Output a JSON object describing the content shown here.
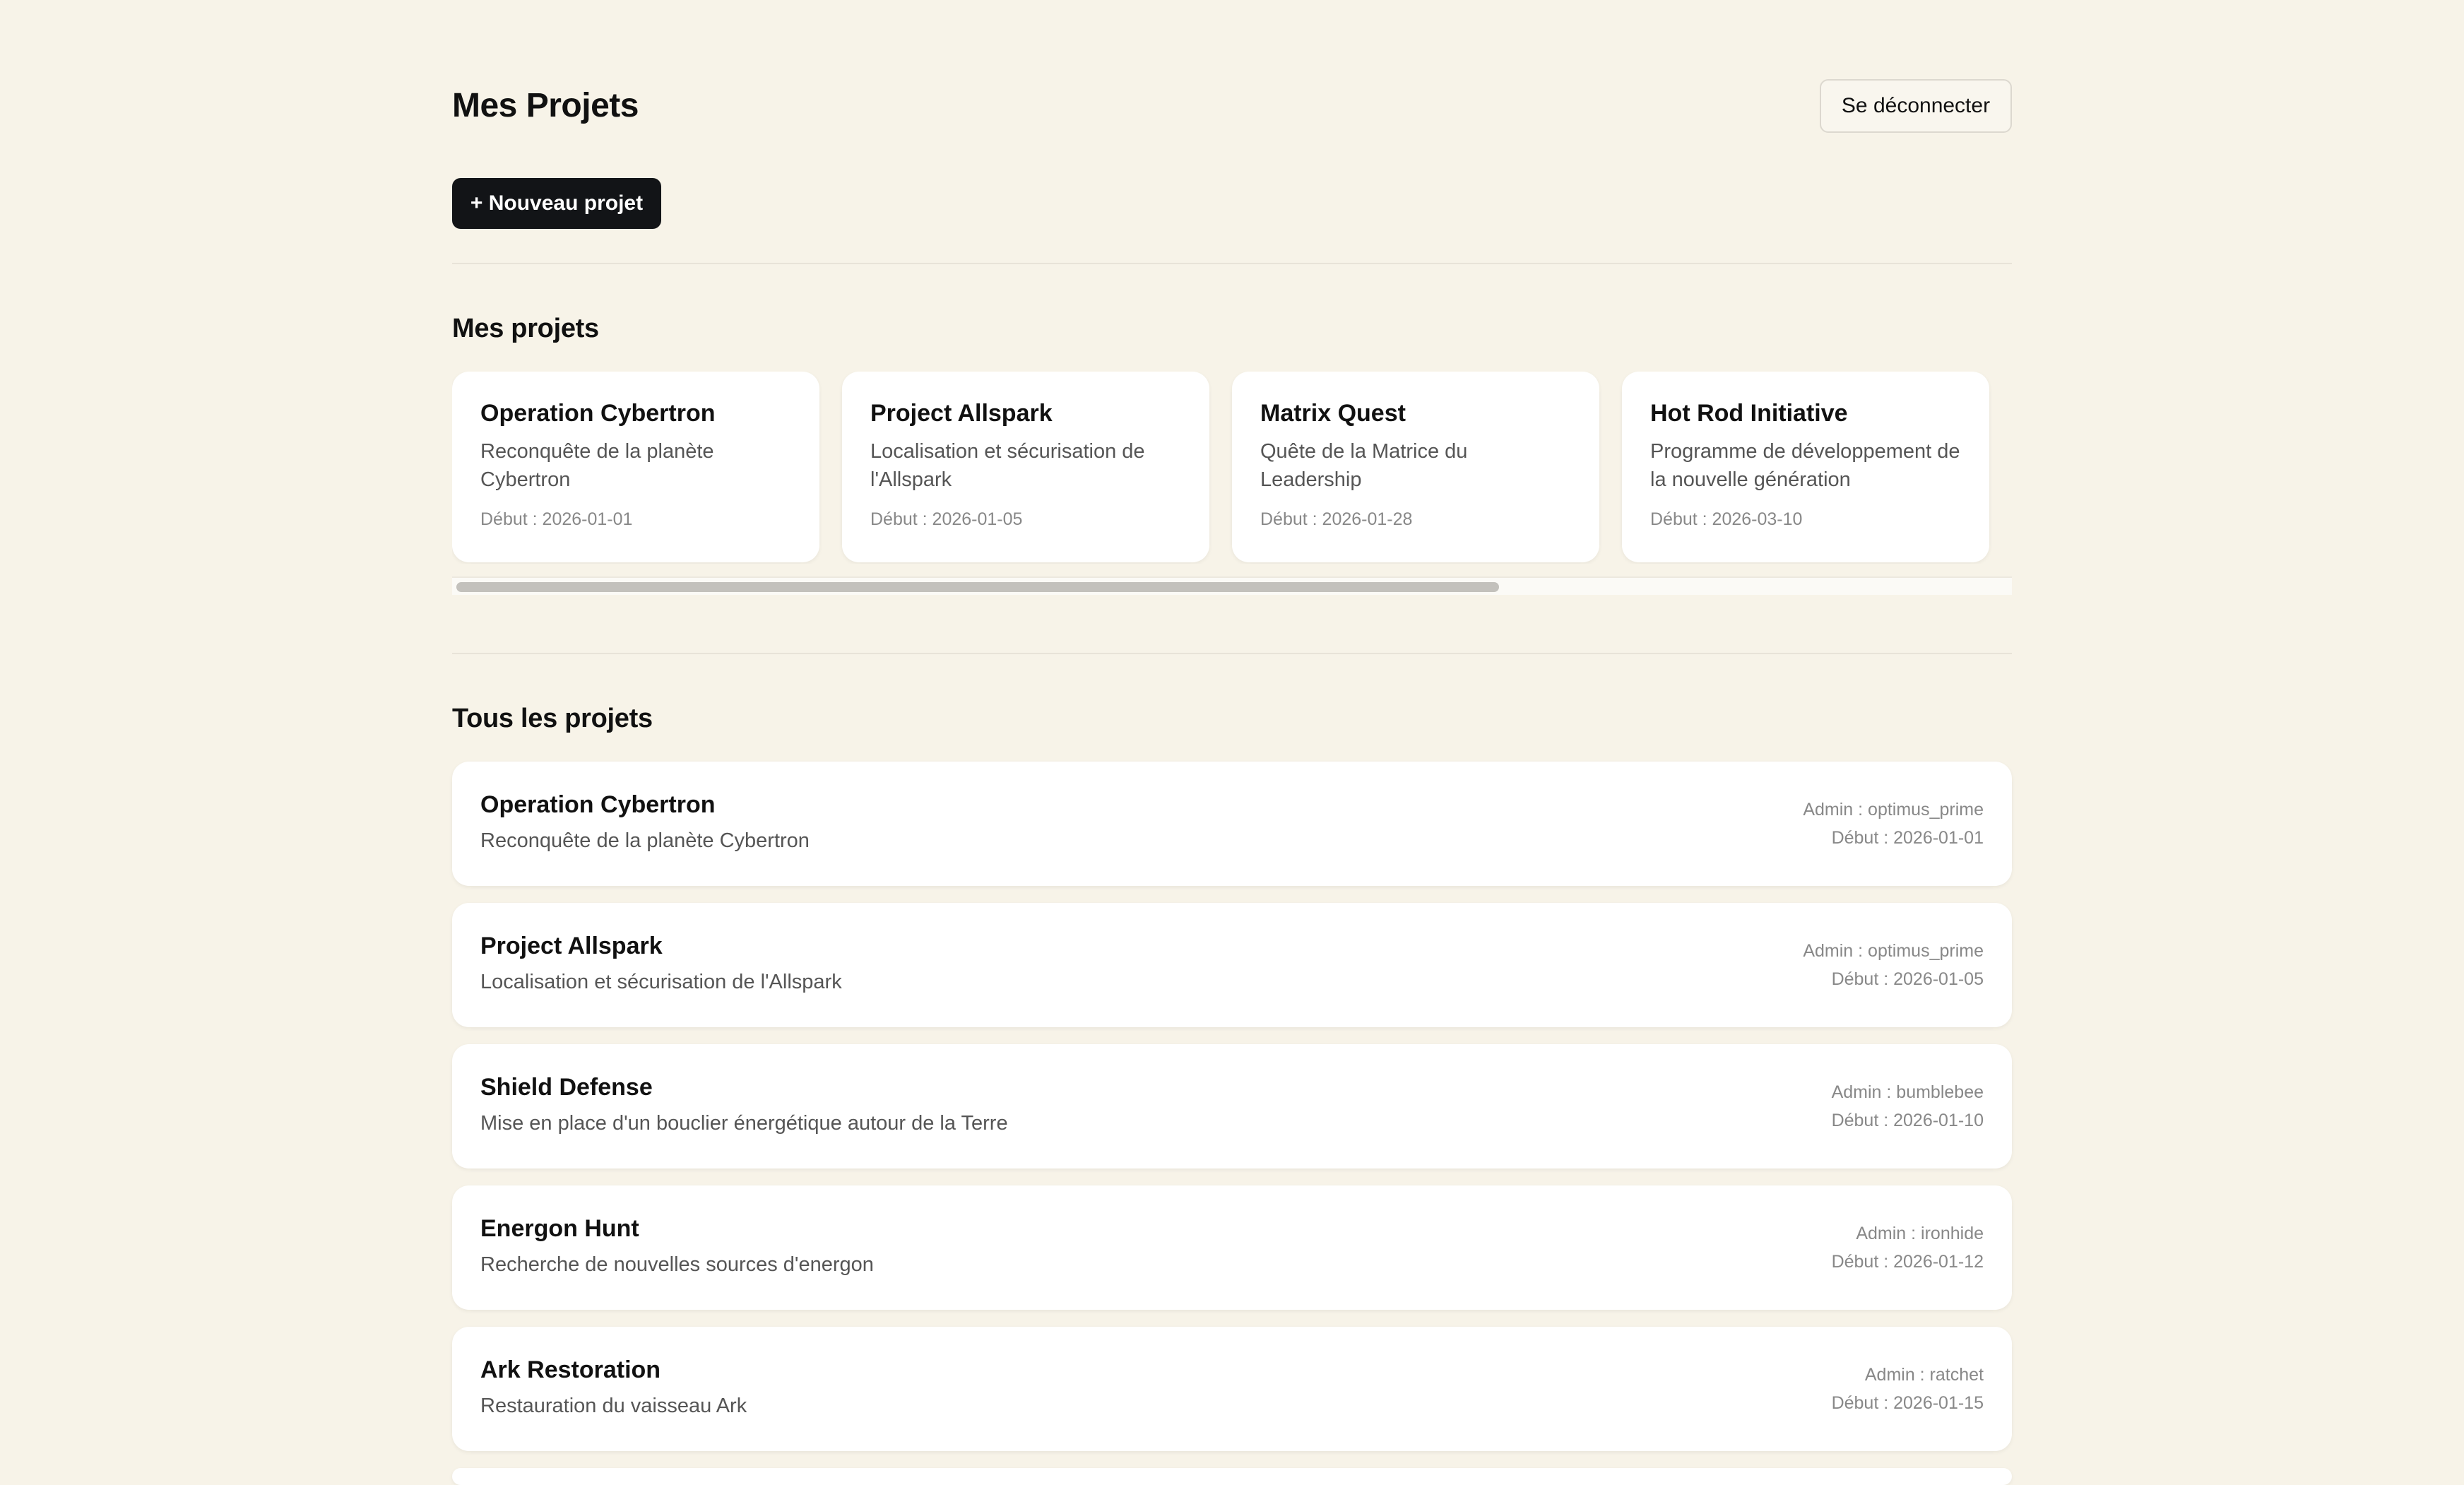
{
  "header": {
    "title": "Mes Projets",
    "logout_label": "Se déconnecter"
  },
  "toolbar": {
    "new_project_label": "+ Nouveau projet"
  },
  "my_projects": {
    "title": "Mes projets",
    "cards": [
      {
        "name": "Operation Cybertron",
        "desc": "Reconquête de la planète Cybertron",
        "date": "Début : 2026-01-01"
      },
      {
        "name": "Project Allspark",
        "desc": "Localisation et sécurisation de l'Allspark",
        "date": "Début : 2026-01-05"
      },
      {
        "name": "Matrix Quest",
        "desc": "Quête de la Matrice du Leadership",
        "date": "Début : 2026-01-28"
      },
      {
        "name": "Hot Rod Initiative",
        "desc": "Programme de développement de la nouvelle génération",
        "date": "Début : 2026-03-10"
      }
    ]
  },
  "all_projects": {
    "title": "Tous les projets",
    "items": [
      {
        "name": "Operation Cybertron",
        "desc": "Reconquête de la planète Cybertron",
        "admin": "Admin : optimus_prime",
        "date": "Début : 2026-01-01"
      },
      {
        "name": "Project Allspark",
        "desc": "Localisation et sécurisation de l'Allspark",
        "admin": "Admin : optimus_prime",
        "date": "Début : 2026-01-05"
      },
      {
        "name": "Shield Defense",
        "desc": "Mise en place d'un bouclier énergétique autour de la Terre",
        "admin": "Admin : bumblebee",
        "date": "Début : 2026-01-10"
      },
      {
        "name": "Energon Hunt",
        "desc": "Recherche de nouvelles sources d'energon",
        "admin": "Admin : ironhide",
        "date": "Début : 2026-01-12"
      },
      {
        "name": "Ark Restoration",
        "desc": "Restauration du vaisseau Ark",
        "admin": "Admin : ratchet",
        "date": "Début : 2026-01-15"
      }
    ]
  },
  "colors": {
    "background": "#f7f3e8",
    "primary_button": "#121417",
    "card": "#ffffff"
  }
}
